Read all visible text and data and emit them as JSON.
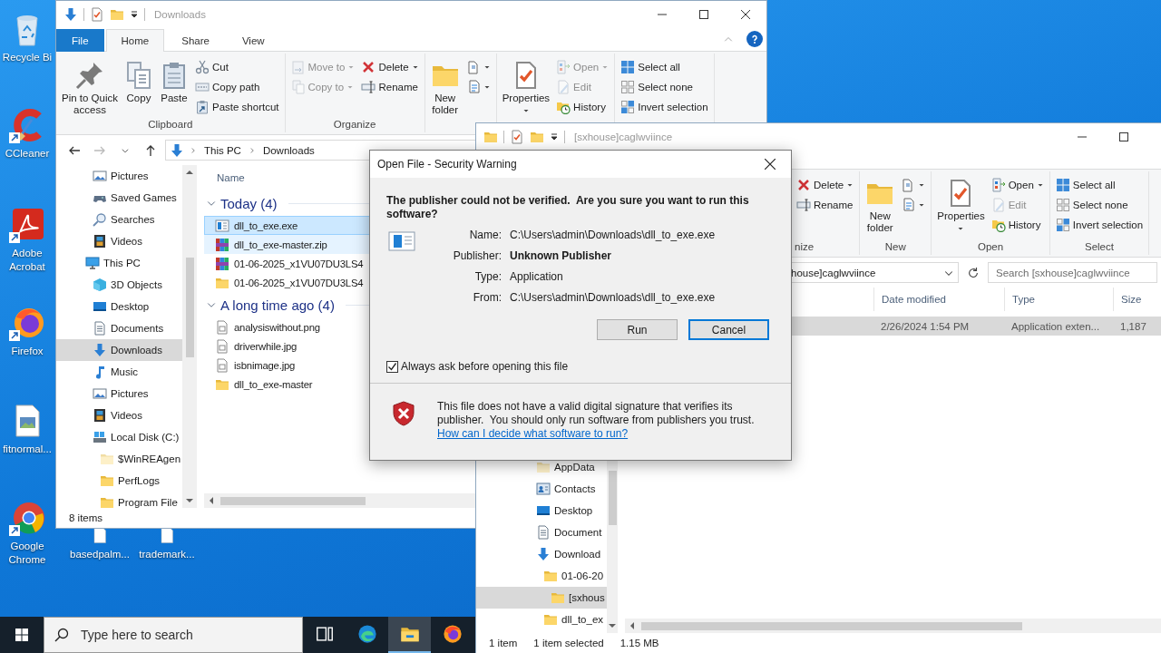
{
  "desktop": {
    "icons": [
      {
        "label": "Recycle Bi",
        "kind": "recycle"
      },
      {
        "label": "CCleaner",
        "kind": "ccleaner"
      },
      {
        "label": "Adobe Acrobat",
        "kind": "acrobat"
      },
      {
        "label": "Firefox",
        "kind": "firefox"
      },
      {
        "label": "fitnormal...",
        "kind": "image"
      },
      {
        "label": "Google Chrome",
        "kind": "chrome"
      },
      {
        "label": "basedpalm...",
        "kind": "file"
      },
      {
        "label": "trademark...",
        "kind": "file"
      }
    ]
  },
  "explorer": {
    "title": "Downloads",
    "tabs": [
      {
        "label": "File",
        "kind": "menu",
        "selected": false
      },
      {
        "label": "Home",
        "kind": "tab",
        "selected": true
      },
      {
        "label": "Share",
        "kind": "tab",
        "selected": false
      },
      {
        "label": "View",
        "kind": "tab",
        "selected": false
      }
    ],
    "ribbon": [
      {
        "label": "Clipboard",
        "columns": [
          [
            {
              "label": "Pin to Quick\naccess",
              "kind": "pin",
              "disabled": false,
              "dropdown": false
            }
          ],
          [
            {
              "label": "Copy",
              "kind": "copy",
              "disabled": false,
              "dropdown": false
            }
          ],
          [
            {
              "label": "Paste",
              "kind": "paste",
              "disabled": false,
              "dropdown": false
            }
          ],
          [
            {
              "label": "Cut",
              "kind": "cut",
              "disabled": false,
              "dropdown": false
            },
            {
              "label": "Copy path",
              "kind": "copypath",
              "disabled": false,
              "dropdown": false
            },
            {
              "label": "Paste shortcut",
              "kind": "pasteshortcut",
              "disabled": false,
              "dropdown": false
            }
          ]
        ]
      },
      {
        "label": "Organize",
        "columns": [
          [
            {
              "label": "Move to",
              "kind": "moveto",
              "disabled": true,
              "dropdown": true
            },
            {
              "label": "Copy to",
              "kind": "copyto",
              "disabled": true,
              "dropdown": true
            }
          ],
          [
            {
              "label": "Delete",
              "kind": "delete",
              "disabled": false,
              "dropdown": true
            },
            {
              "label": "Rename",
              "kind": "rename",
              "disabled": false,
              "dropdown": false
            }
          ]
        ]
      },
      {
        "columns": [
          [
            {
              "label": "New\nfolder",
              "kind": "newfolder",
              "disabled": false,
              "dropdown": false
            }
          ],
          [
            {
              "kind": "newitem",
              "disabled": false,
              "dropdown": true
            },
            {
              "kind": "easyaccess",
              "disabled": false,
              "dropdown": true
            }
          ]
        ]
      },
      {
        "columns": [
          [
            {
              "label": "Properties",
              "kind": "properties",
              "disabled": false,
              "dropdown": true
            }
          ],
          [
            {
              "label": "Open",
              "kind": "open",
              "disabled": true,
              "dropdown": true
            },
            {
              "label": "Edit",
              "kind": "edit",
              "disabled": true,
              "dropdown": false
            },
            {
              "label": "History",
              "kind": "history",
              "disabled": false,
              "dropdown": false
            }
          ]
        ]
      },
      {
        "columns": [
          [
            {
              "label": "Select all",
              "kind": "selectall",
              "disabled": false,
              "dropdown": false
            },
            {
              "label": "Select none",
              "kind": "selectnone",
              "disabled": false,
              "dropdown": false
            },
            {
              "label": "Invert selection",
              "kind": "invert",
              "disabled": false,
              "dropdown": false
            }
          ]
        ]
      }
    ],
    "address": [
      "This PC",
      "Downloads"
    ],
    "nav": [
      {
        "children": [
          {
            "label": "Pictures",
            "kind": "pictures",
            "selected": false
          },
          {
            "label": "Saved Games",
            "kind": "games",
            "selected": false
          },
          {
            "label": "Searches",
            "kind": "search",
            "selected": false
          },
          {
            "label": "Videos",
            "kind": "videos",
            "selected": false
          }
        ]
      },
      {
        "label": "This PC",
        "kind": "pc",
        "selected": false,
        "children": [
          {
            "label": "3D Objects",
            "kind": "objects",
            "selected": false
          },
          {
            "label": "Desktop",
            "kind": "desktop",
            "selected": false
          },
          {
            "label": "Documents",
            "kind": "documents",
            "selected": false
          },
          {
            "label": "Downloads",
            "kind": "downloads",
            "selected": true
          },
          {
            "label": "Music",
            "kind": "music",
            "selected": false
          },
          {
            "label": "Pictures",
            "kind": "pictures",
            "selected": false
          },
          {
            "label": "Videos",
            "kind": "videos",
            "selected": false
          },
          {
            "label": "Local Disk (C:)",
            "kind": "disk",
            "selected": false,
            "children": [
              {
                "label": "$WinREAgen",
                "kind": "folderfaded",
                "selected": false
              },
              {
                "label": "PerfLogs",
                "kind": "folder",
                "selected": false
              },
              {
                "label": "Program File",
                "kind": "folder",
                "selected": false
              }
            ]
          }
        ]
      }
    ],
    "column": "Name",
    "groups": [
      {
        "label": "Today (4)",
        "expanded": true,
        "items": [
          {
            "name": "dll_to_exe.exe",
            "kind": "exe",
            "selected": true,
            "hover": false
          },
          {
            "name": "dll_to_exe-master.zip",
            "kind": "zip",
            "selected": false,
            "hover": true
          },
          {
            "name": "01-06-2025_x1VU07DU3LS4",
            "kind": "zip",
            "selected": false,
            "hover": false
          },
          {
            "name": "01-06-2025_x1VU07DU3LS4",
            "kind": "folder",
            "selected": false,
            "hover": false
          }
        ]
      },
      {
        "label": "A long time ago (4)",
        "expanded": true,
        "items": [
          {
            "name": "analysiswithout.png",
            "kind": "image",
            "selected": false,
            "hover": false
          },
          {
            "name": "driverwhile.jpg",
            "kind": "image",
            "selected": false,
            "hover": false
          },
          {
            "name": "isbnimage.jpg",
            "kind": "image",
            "selected": false,
            "hover": false
          },
          {
            "name": "dll_to_exe-master",
            "kind": "folder",
            "selected": false,
            "hover": false
          }
        ]
      }
    ],
    "status": "8 items"
  },
  "explorer2": {
    "title": "[sxhouse]caglwviince",
    "ribbon": [
      {
        "label": "nize",
        "columns": [
          [
            {
              "label": "Delete",
              "kind": "delete",
              "disabled": false,
              "dropdown": true
            },
            {
              "label": "Rename",
              "kind": "rename",
              "disabled": false,
              "dropdown": false
            }
          ]
        ]
      },
      {
        "label": "New",
        "columns": [
          [
            {
              "label": "New\nfolder",
              "kind": "newfolder",
              "disabled": false,
              "dropdown": false
            }
          ],
          [
            {
              "kind": "newitem",
              "disabled": false,
              "dropdown": true
            },
            {
              "kind": "easyaccess",
              "disabled": false,
              "dropdown": true
            }
          ]
        ]
      },
      {
        "label": "Open",
        "columns": [
          [
            {
              "label": "Properties",
              "kind": "properties",
              "disabled": false,
              "dropdown": true
            }
          ],
          [
            {
              "label": "Open",
              "kind": "open",
              "disabled": false,
              "dropdown": true
            },
            {
              "label": "Edit",
              "kind": "edit",
              "disabled": true,
              "dropdown": false
            },
            {
              "label": "History",
              "kind": "history",
              "disabled": false,
              "dropdown": false
            }
          ]
        ]
      },
      {
        "label": "Select",
        "columns": [
          [
            {
              "label": "Select all",
              "kind": "selectall",
              "disabled": false,
              "dropdown": false
            },
            {
              "label": "Select none",
              "kind": "selectnone",
              "disabled": false,
              "dropdown": false
            },
            {
              "label": "Invert selection",
              "kind": "invert",
              "disabled": false,
              "dropdown": false
            }
          ]
        ]
      }
    ],
    "address": "house]caglwviince",
    "search_placeholder": "Search [sxhouse]caglwviince",
    "columns": [
      "Date modified",
      "Type",
      "Size"
    ],
    "rows": [
      {
        "cells": [
          "2/26/2024 1:54 PM",
          "Application exten...",
          "1,187"
        ],
        "selected": true
      }
    ],
    "nav": [
      {
        "children": [
          {
            "label": "AppData",
            "kind": "folderfaded",
            "selected": false
          },
          {
            "label": "Contacts",
            "kind": "contacts",
            "selected": false
          },
          {
            "label": "Desktop",
            "kind": "desktop",
            "selected": false
          },
          {
            "label": "Document",
            "kind": "documents",
            "selected": false
          },
          {
            "label": "Download",
            "kind": "downloads",
            "selected": false,
            "children": [
              {
                "label": "01-06-20",
                "kind": "folder",
                "selected": false,
                "children": [
                  {
                    "label": "[sxhous",
                    "kind": "folder",
                    "selected": true
                  }
                ]
              },
              {
                "label": "dll_to_ex",
                "kind": "folder",
                "selected": false
              }
            ]
          }
        ]
      }
    ],
    "status": [
      "1 item",
      "1 item selected",
      "1.15 MB"
    ]
  },
  "dialog": {
    "title": "Open File - Security Warning",
    "heading": "The publisher could not be verified.  Are you sure you want to run this software?",
    "fields": [
      {
        "label": "Name:",
        "value": "C:\\Users\\admin\\Downloads\\dll_to_exe.exe",
        "bold": false
      },
      {
        "label": "Publisher:",
        "value": "Unknown Publisher",
        "bold": true
      },
      {
        "label": "Type:",
        "value": "Application",
        "bold": false
      },
      {
        "label": "From:",
        "value": "C:\\Users\\admin\\Downloads\\dll_to_exe.exe",
        "bold": false
      }
    ],
    "buttons": [
      {
        "label": "Run",
        "default": false
      },
      {
        "label": "Cancel",
        "default": true
      }
    ],
    "checkbox": {
      "label": "Always ask before opening this file",
      "checked": true
    },
    "warning": "This file does not have a valid digital signature that verifies its publisher.  You should only run software from publishers you trust.",
    "link": "How can I decide what software to run?"
  },
  "taskbar": {
    "search_placeholder": "Type here to search",
    "apps": [
      {
        "kind": "taskview",
        "active": false
      },
      {
        "kind": "edge",
        "active": false
      },
      {
        "kind": "explorer",
        "active": true
      },
      {
        "kind": "firefox",
        "active": false
      }
    ]
  }
}
